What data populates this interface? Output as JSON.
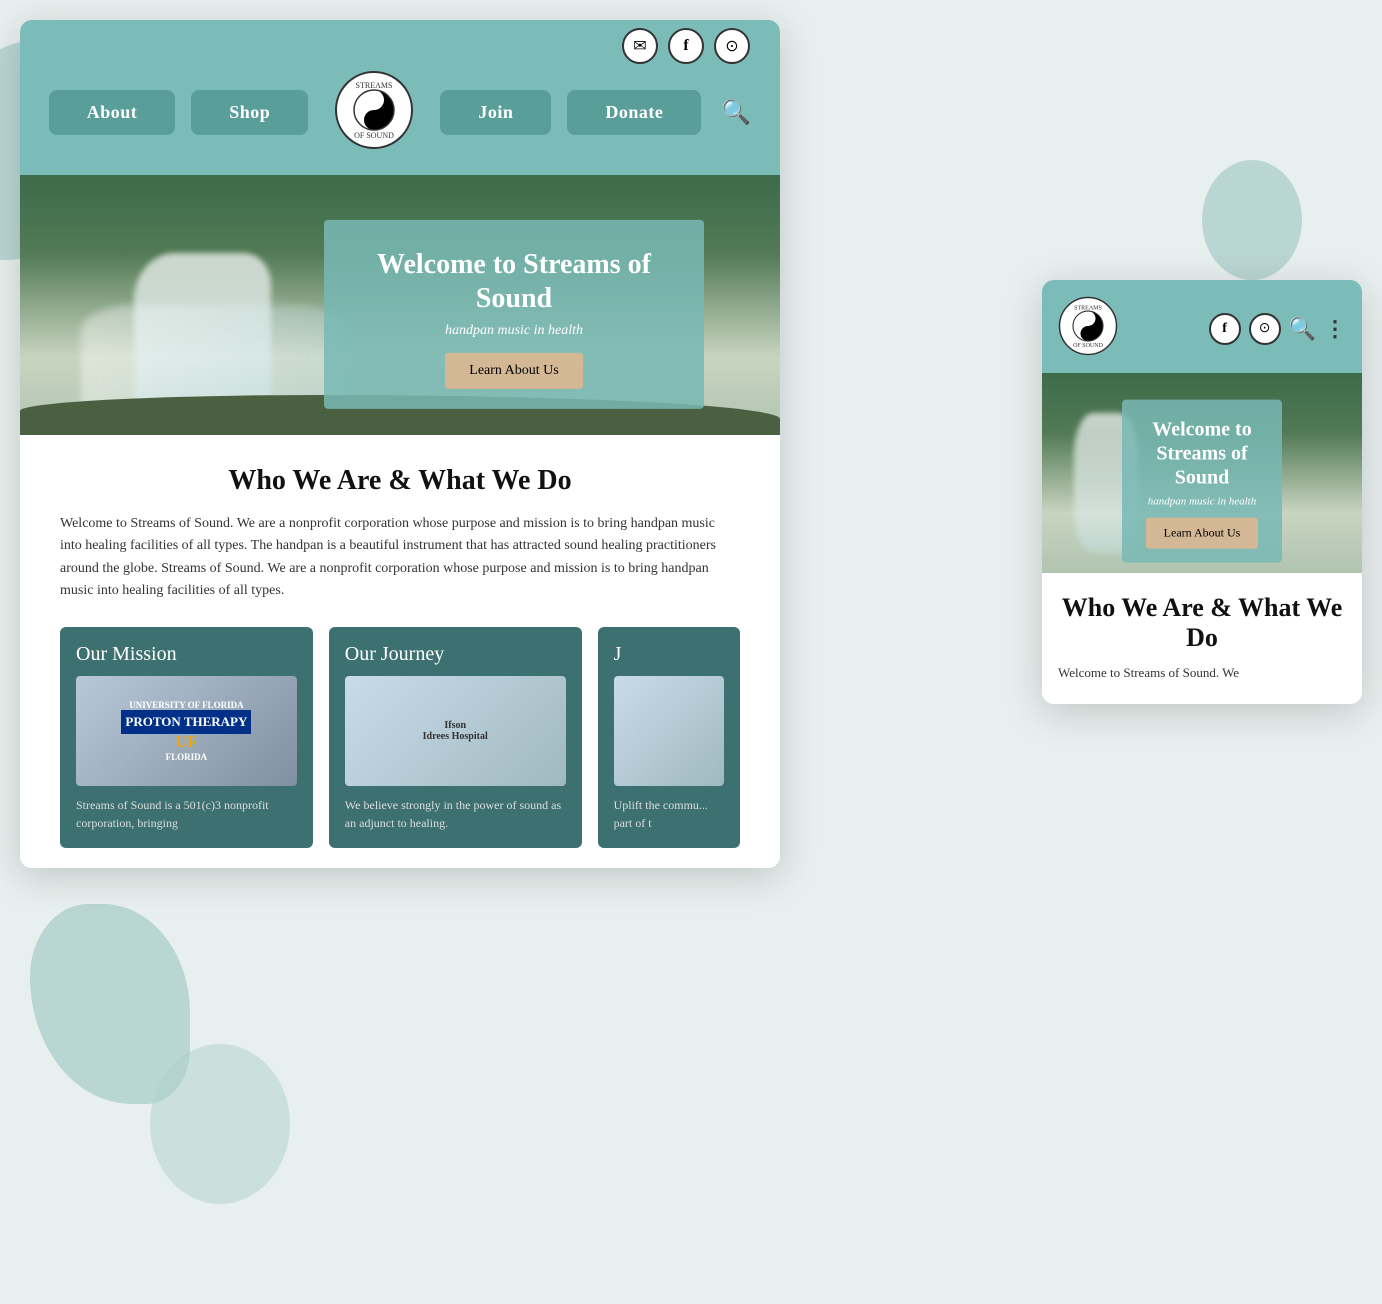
{
  "site": {
    "name": "Streams of Sound",
    "tagline": "handpan music in health"
  },
  "desktop": {
    "nav": {
      "links": [
        "About",
        "Shop",
        "Join",
        "Donate"
      ],
      "icons": [
        "✉",
        "f",
        "◷"
      ]
    },
    "hero": {
      "title": "Welcome to Streams of Sound",
      "subtitle": "handpan music in health",
      "cta": "Learn About Us"
    },
    "section": {
      "title": "Who We Are & What We Do",
      "text": "Welcome to Streams of Sound. We are a nonprofit corporation whose purpose and mission is to bring handpan music into healing facilities of all types. The handpan is a beautiful instrument that has attracted sound healing practitioners around the globe. Streams of Sound. We are a nonprofit corporation whose purpose and mission is to bring handpan music into healing facilities of all types."
    },
    "cards": [
      {
        "title": "Our Mission",
        "img_label": "UF PROTON THERAPY",
        "text": "Streams of Sound is a 501(c)3 nonprofit corporation, bringing"
      },
      {
        "title": "Our Journey",
        "img_label": "Ifson Idrees Hospital",
        "text": "We believe strongly in the power of sound as an adjunct to healing."
      },
      {
        "title": "J",
        "img_label": "",
        "text": "Uplift the commu... part of t"
      }
    ]
  },
  "mobile": {
    "icons": [
      "f",
      "◷"
    ],
    "hero": {
      "title": "Welcome to Streams of Sound",
      "subtitle": "handpan music in health",
      "cta": "Learn About Us"
    },
    "section": {
      "title": "Who We Are & What We Do",
      "text": "Welcome to Streams of Sound. We"
    }
  }
}
